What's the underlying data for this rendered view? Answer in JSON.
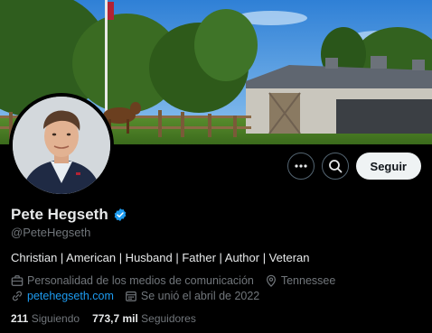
{
  "profile": {
    "name": "Pete Hegseth",
    "handle": "@PeteHegseth",
    "bio": "Christian | American | Husband | Father | Author | Veteran",
    "category": "Personalidad de los medios de comunicación",
    "location": "Tennessee",
    "website": "petehegseth.com",
    "joined": "Se unió el abril de 2022",
    "following_count": "211",
    "following_label": "Siguiendo",
    "followers_count": "773,7 mil",
    "followers_label": "Seguidores",
    "verified": true
  },
  "actions": {
    "more_icon": "more-horizontal-icon",
    "search_icon": "search-icon",
    "follow_label": "Seguir"
  },
  "colors": {
    "background": "#000000",
    "primary_text": "#e7e9ea",
    "secondary_text": "#71767b",
    "link": "#1d9bf0",
    "verified_badge": "#1d9bf0",
    "follow_button_bg": "#eff3f4"
  }
}
